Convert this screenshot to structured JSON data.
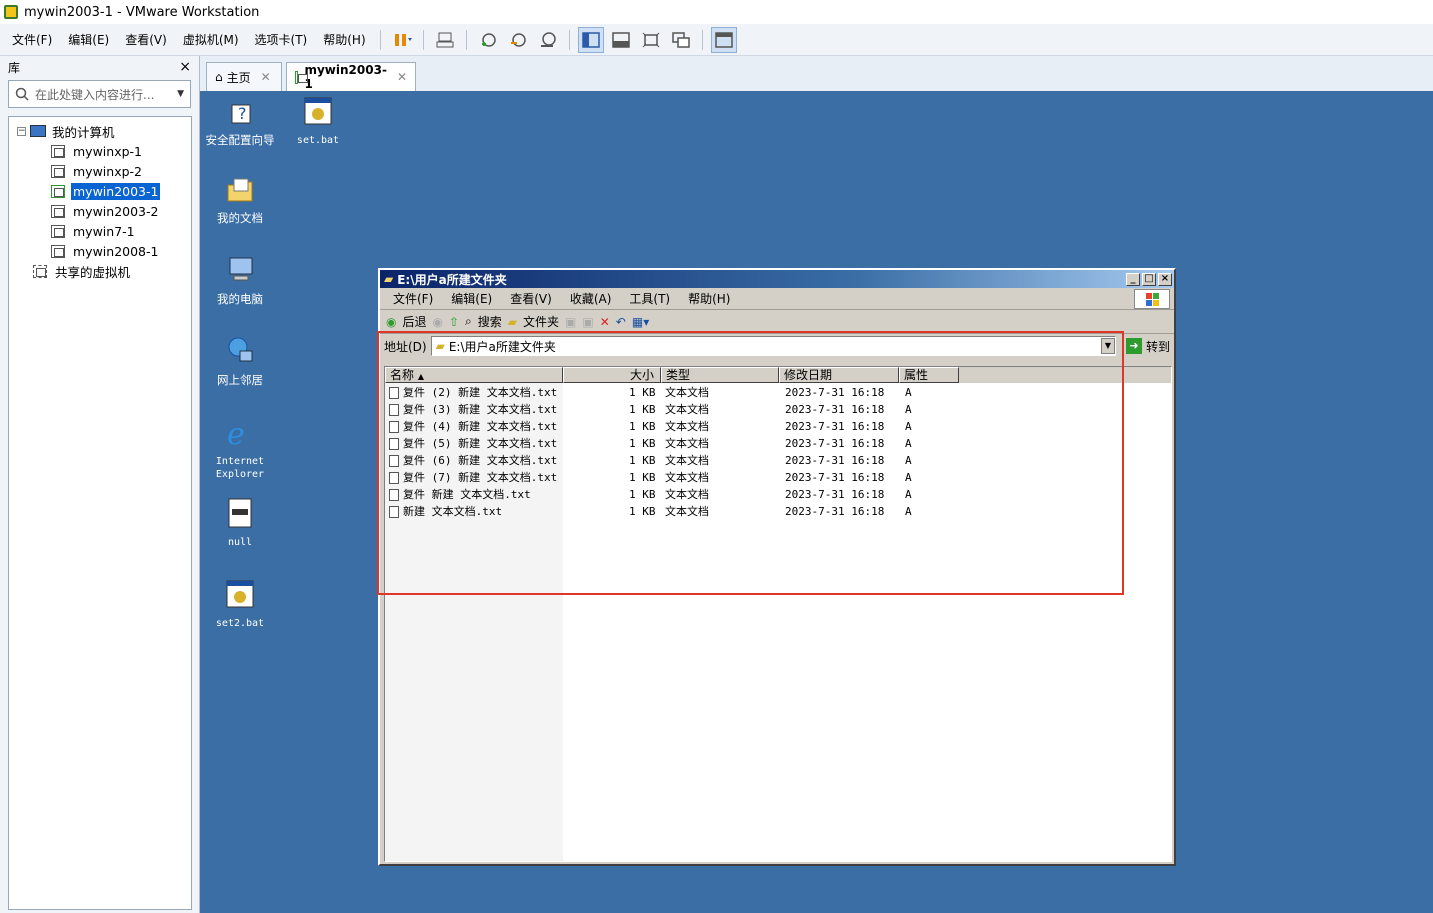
{
  "window": {
    "title": "mywin2003-1 - VMware Workstation"
  },
  "menu": [
    "文件(F)",
    "编辑(E)",
    "查看(V)",
    "虚拟机(M)",
    "选项卡(T)",
    "帮助(H)"
  ],
  "toolbar_icons": [
    "pause-icon",
    "send-keys-icon",
    "snapshot-icon",
    "revert-snapshot-icon",
    "snapshot-manager-icon",
    "show-library-icon",
    "thumbnail-icon",
    "fullscreen-icon",
    "unity-icon",
    "console-view-icon"
  ],
  "library": {
    "title": "库",
    "close": "×",
    "search_placeholder": "在此处键入内容进行...",
    "tree": {
      "root": "我的计算机",
      "vms": [
        "mywinxp-1",
        "mywinxp-2",
        "mywin2003-1",
        "mywin2003-2",
        "mywin7-1",
        "mywin2008-1"
      ],
      "selected": "mywin2003-1",
      "shared": "共享的虚拟机"
    }
  },
  "tabs": [
    {
      "label": "主页"
    },
    {
      "label": "mywin2003-1"
    }
  ],
  "desktop": {
    "icons": [
      {
        "label": "安全配置向导",
        "icon": "security-wizard-icon"
      },
      {
        "label": "set.bat",
        "icon": "batch-file-icon"
      },
      {
        "label": "我的文档",
        "icon": "my-documents-icon"
      },
      {
        "label": "我的电脑",
        "icon": "my-computer-icon"
      },
      {
        "label": "网上邻居",
        "icon": "network-places-icon"
      },
      {
        "label": "Internet Explorer",
        "icon": "internet-explorer-icon"
      },
      {
        "label": "null",
        "icon": "generic-file-icon"
      },
      {
        "label": "set2.bat",
        "icon": "batch-file-icon"
      }
    ]
  },
  "explorer": {
    "title": "E:\\用户a所建文件夹",
    "menu": [
      "文件(F)",
      "编辑(E)",
      "查看(V)",
      "收藏(A)",
      "工具(T)",
      "帮助(H)"
    ],
    "toolbar": {
      "back": "后退",
      "search": "搜索",
      "folders": "文件夹"
    },
    "address_label": "地址(D)",
    "address": "E:\\用户a所建文件夹",
    "go": "转到",
    "columns": [
      "名称",
      "大小",
      "类型",
      "修改日期",
      "属性"
    ],
    "files": [
      {
        "name": "复件 (2) 新建 文本文档.txt",
        "size": "1 KB",
        "type": "文本文档",
        "date": "2023-7-31 16:18",
        "attr": "A"
      },
      {
        "name": "复件 (3) 新建 文本文档.txt",
        "size": "1 KB",
        "type": "文本文档",
        "date": "2023-7-31 16:18",
        "attr": "A"
      },
      {
        "name": "复件 (4) 新建 文本文档.txt",
        "size": "1 KB",
        "type": "文本文档",
        "date": "2023-7-31 16:18",
        "attr": "A"
      },
      {
        "name": "复件 (5) 新建 文本文档.txt",
        "size": "1 KB",
        "type": "文本文档",
        "date": "2023-7-31 16:18",
        "attr": "A"
      },
      {
        "name": "复件 (6) 新建 文本文档.txt",
        "size": "1 KB",
        "type": "文本文档",
        "date": "2023-7-31 16:18",
        "attr": "A"
      },
      {
        "name": "复件 (7) 新建 文本文档.txt",
        "size": "1 KB",
        "type": "文本文档",
        "date": "2023-7-31 16:18",
        "attr": "A"
      },
      {
        "name": "复件 新建 文本文档.txt",
        "size": "1 KB",
        "type": "文本文档",
        "date": "2023-7-31 16:18",
        "attr": "A"
      },
      {
        "name": "新建 文本文档.txt",
        "size": "1 KB",
        "type": "文本文档",
        "date": "2023-7-31 16:18",
        "attr": "A"
      }
    ]
  },
  "colors": {
    "vm_desktop": "#3a6ea5",
    "highlight": "#e0362a",
    "selection": "#0a64d2"
  }
}
